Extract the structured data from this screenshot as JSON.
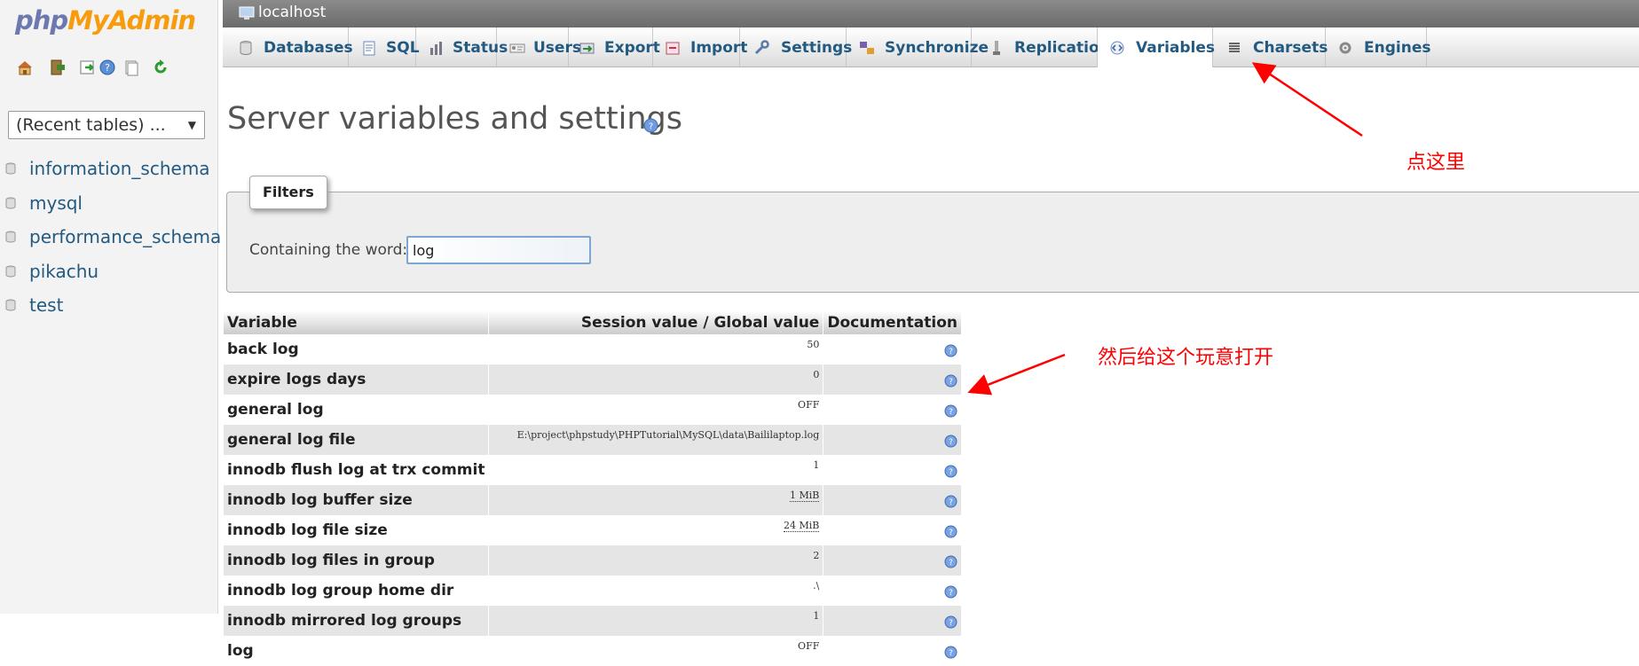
{
  "sidebar": {
    "logo": {
      "php": "php",
      "my": "My",
      "admin": "Admin"
    },
    "nav_icons": [
      "home-icon",
      "exit-icon",
      "query-window-icon",
      "help-icon",
      "docs-icon",
      "reload-icon"
    ],
    "recent_tables": "(Recent tables) ...",
    "databases": [
      "information_schema",
      "mysql",
      "performance_schema",
      "pikachu",
      "test"
    ]
  },
  "server": {
    "title": "localhost"
  },
  "tabs": [
    {
      "label": "Databases",
      "icon": "database-icon"
    },
    {
      "label": "SQL",
      "icon": "sql-icon"
    },
    {
      "label": "Status",
      "icon": "status-icon"
    },
    {
      "label": "Users",
      "icon": "users-icon"
    },
    {
      "label": "Export",
      "icon": "export-icon"
    },
    {
      "label": "Import",
      "icon": "import-icon"
    },
    {
      "label": "Settings",
      "icon": "wrench-icon"
    },
    {
      "label": "Synchronize",
      "icon": "synchronize-icon"
    },
    {
      "label": "Replication",
      "icon": "replication-icon"
    },
    {
      "label": "Variables",
      "icon": "variables-icon",
      "active": true
    },
    {
      "label": "Charsets",
      "icon": "charsets-icon"
    },
    {
      "label": "Engines",
      "icon": "engines-icon"
    }
  ],
  "page": {
    "title": "Server variables and settings"
  },
  "filters": {
    "legend": "Filters",
    "label": "Containing the word:",
    "value": "log"
  },
  "table": {
    "headers": {
      "variable": "Variable",
      "value": "Session value / Global value",
      "doc": "Documentation"
    },
    "rows": [
      {
        "name": "back log",
        "value": "50"
      },
      {
        "name": "expire logs days",
        "value": "0"
      },
      {
        "name": "general log",
        "value": "OFF"
      },
      {
        "name": "general log file",
        "value": "E:\\project\\phpstudy\\PHPTutorial\\MySQL\\data\\Baililaptop.log"
      },
      {
        "name": "innodb flush log at trx commit",
        "value": "1"
      },
      {
        "name": "innodb log buffer size",
        "value": "1 MiB",
        "abbr": true
      },
      {
        "name": "innodb log file size",
        "value": "24 MiB",
        "abbr": true
      },
      {
        "name": "innodb log files in group",
        "value": "2"
      },
      {
        "name": "innodb log group home dir",
        "value": ".\\"
      },
      {
        "name": "innodb mirrored log groups",
        "value": "1"
      },
      {
        "name": "log",
        "value": "OFF"
      }
    ]
  },
  "annotations": {
    "click_here": "点这里",
    "then_open": "然后给这个玩意打开"
  },
  "colors": {
    "link": "#235a81",
    "annotation": "#ff0000",
    "server_bar": "#7a7a7a",
    "logo_php": "#6c78af",
    "logo_admin": "#f89c0e"
  }
}
